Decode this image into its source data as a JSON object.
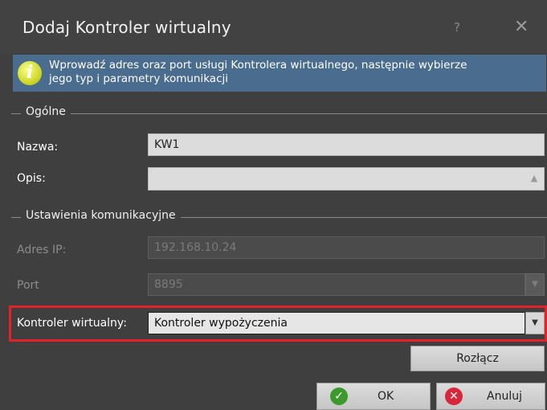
{
  "window": {
    "title": "Dodaj Kontroler wirtualny",
    "help_glyph": "?",
    "close_glyph": "✕"
  },
  "info": {
    "icon_letter": "i",
    "line1": "Wprowadź adres oraz port usługi Kontrolera wirtualnego, następnie wybierze",
    "line2": "jego typ i parametry komunikacji"
  },
  "general": {
    "title": "Ogólne",
    "name_label": "Nazwa:",
    "name_value": "KW1",
    "desc_label": "Opis:",
    "desc_value": ""
  },
  "comm": {
    "title": "Ustawienia komunikacyjne",
    "ip_label": "Adres IP:",
    "ip_value": "192.168.10.24",
    "port_label": "Port",
    "port_value": "8895",
    "vc_label": "Kontroler wirtualny:",
    "vc_value": "Kontroler wypożyczenia",
    "disconnect_label": "Rozłącz"
  },
  "footer": {
    "ok_label": "OK",
    "cancel_label": "Anuluj"
  },
  "colors": {
    "highlight": "#e2212b",
    "info_bg": "#4a6c8e",
    "window_bg": "#3f3f3f"
  }
}
